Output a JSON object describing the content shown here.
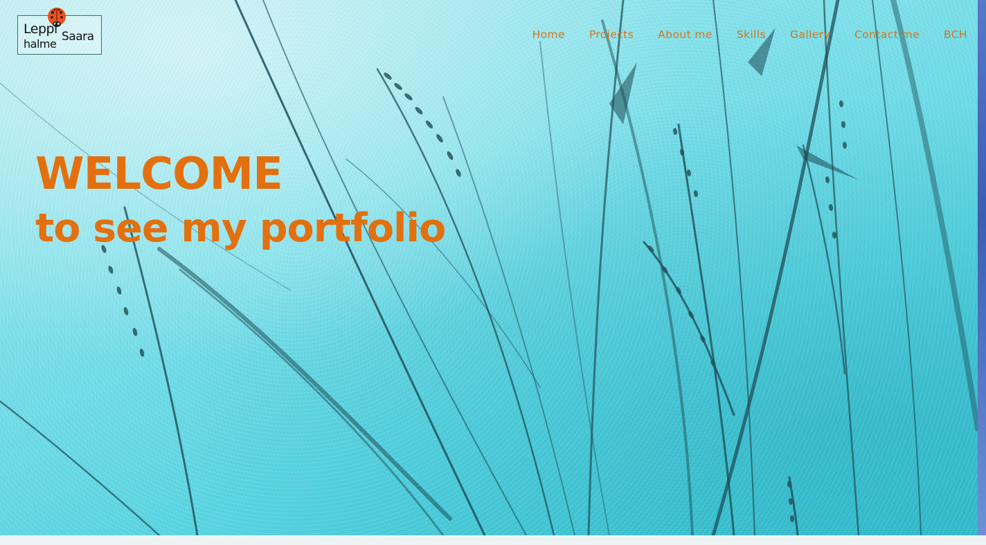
{
  "logo": {
    "line1": "Leppi",
    "line2": "halme",
    "line3": "Saara"
  },
  "nav": {
    "items": [
      {
        "label": "Home"
      },
      {
        "label": "Projects"
      },
      {
        "label": "About me"
      },
      {
        "label": "Skills"
      },
      {
        "label": "Gallery"
      },
      {
        "label": "Contact me"
      },
      {
        "label": "BCH"
      }
    ]
  },
  "hero": {
    "title_line1": "WELCOME",
    "title_line2": "to see my portfolio"
  },
  "colors": {
    "accent": "#e2700f",
    "nav_text": "#d4741c",
    "background": "#7fe0ea",
    "grass": "#1e4e58"
  },
  "icons": {
    "logo_mascot": "ladybug-icon"
  }
}
